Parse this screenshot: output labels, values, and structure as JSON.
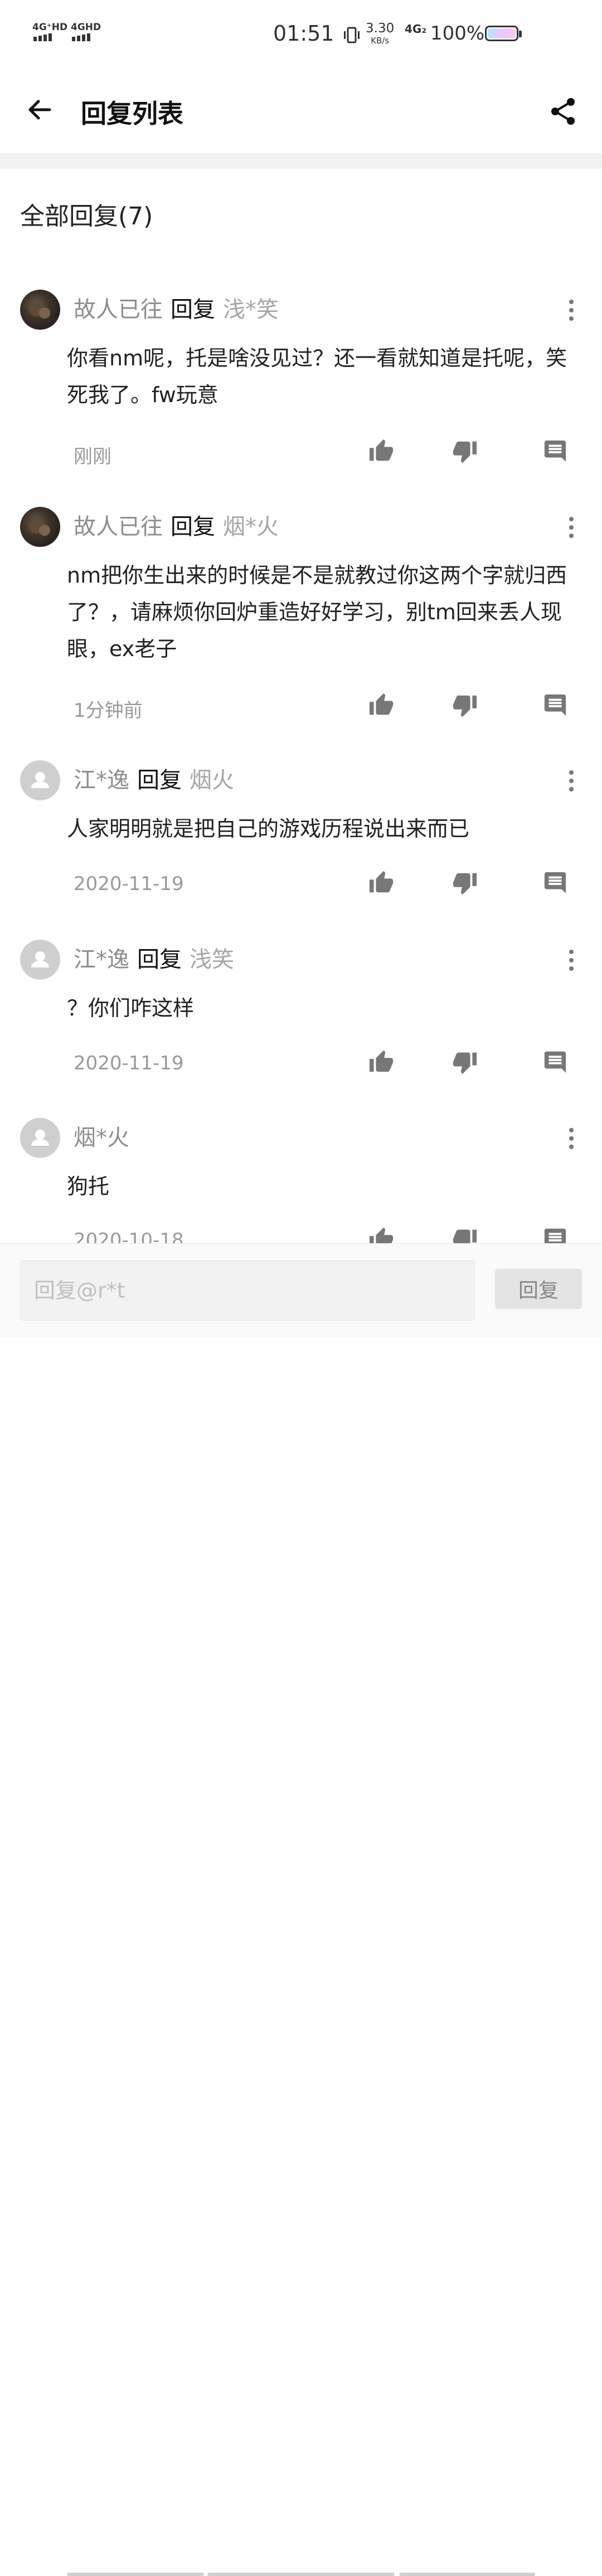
{
  "status_bar": {
    "sim1": "4G⁺HD",
    "sim2": "4GHD",
    "time": "01:51",
    "speed_value": "3.30",
    "speed_unit": "KB/s",
    "network": "4G₂",
    "battery": "100%",
    "icons": [
      "signal-icon",
      "vibrate-icon",
      "battery-icon"
    ]
  },
  "header": {
    "title": "回复列表",
    "back_icon": "arrow-left-icon",
    "share_icon": "share-icon"
  },
  "section": {
    "title": "全部回复(7)"
  },
  "comments": [
    {
      "user": "故人已往",
      "reply_word": "回复",
      "target": "浅*笑",
      "avatar": "photo",
      "text": "你看nm呢，托是啥没见过？还一看就知道是托呢，笑死我了。fw玩意",
      "time": "刚刚"
    },
    {
      "user": "故人已往",
      "reply_word": "回复",
      "target": "烟*火",
      "avatar": "photo",
      "text": "nm把你生出来的时候是不是就教过你这两个字就归西了？，请麻烦你回炉重造好好学习，别tm回来丢人现眼，ex老子",
      "time": "1分钟前"
    },
    {
      "user": "江*逸",
      "reply_word": "回复",
      "target": "烟火",
      "avatar": "default",
      "text": "人家明明就是把自己的游戏历程说出来而已",
      "time": "2020-11-19"
    },
    {
      "user": "江*逸",
      "reply_word": "回复",
      "target": "浅笑",
      "avatar": "default",
      "text": "？你们咋这样",
      "time": "2020-11-19"
    },
    {
      "user": "烟*火",
      "reply_word": "",
      "target": "",
      "avatar": "default",
      "text": "狗托",
      "time": "2020-10-18"
    }
  ],
  "action_icons": [
    "thumb-up-icon",
    "thumb-down-icon",
    "comment-icon",
    "more-vertical-icon"
  ],
  "reply_bar": {
    "placeholder": "回复@r*t",
    "send_label": "回复"
  },
  "colors": {
    "username": "#8e8e8e",
    "icon_gray": "#777777",
    "text_dark": "#222222"
  }
}
